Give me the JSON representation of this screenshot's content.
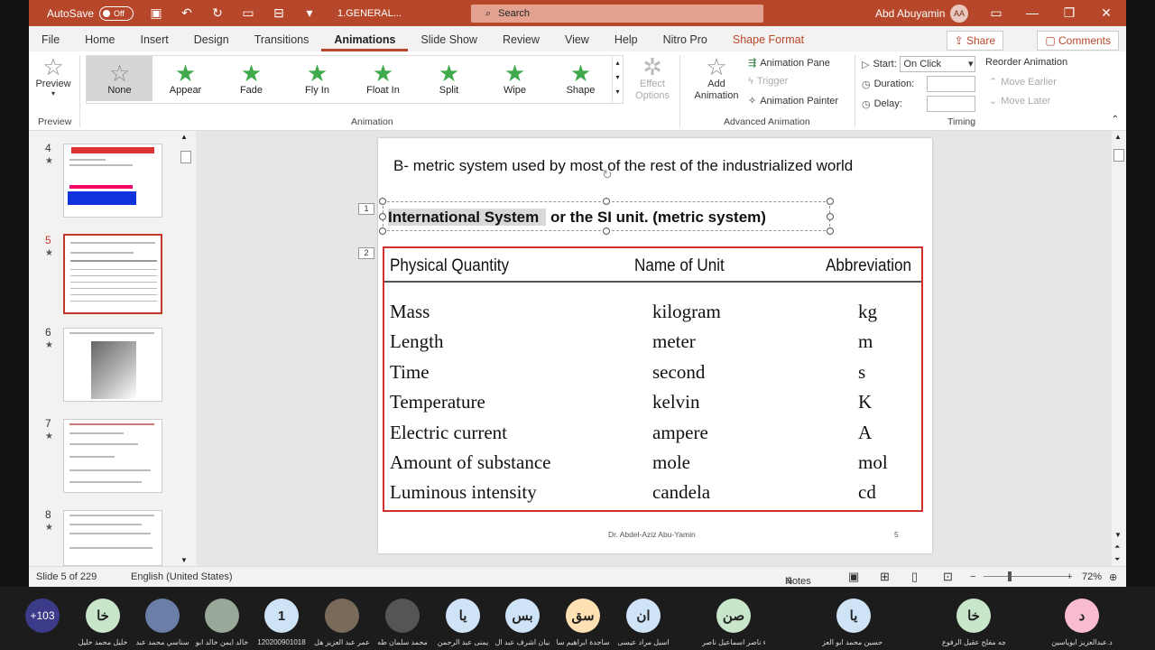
{
  "titlebar": {
    "autosave_label": "AutoSave",
    "autosave_state": "Off",
    "filename": "1.GENERAL...",
    "search_placeholder": "Search",
    "user_name": "Abd Abuyamin",
    "user_initials": "AA"
  },
  "tabs": [
    "File",
    "Home",
    "Insert",
    "Design",
    "Transitions",
    "Animations",
    "Slide Show",
    "Review",
    "View",
    "Help",
    "Nitro Pro",
    "Shape Format"
  ],
  "active_tab": "Animations",
  "share_label": "Share",
  "comments_label": "Comments",
  "ribbon": {
    "preview_label": "Preview",
    "preview_group": "Preview",
    "animation_group": "Animation",
    "gallery": [
      "None",
      "Appear",
      "Fade",
      "Fly In",
      "Float In",
      "Split",
      "Wipe",
      "Shape"
    ],
    "effect_options": "Effect Options",
    "add_animation": "Add Animation",
    "animation_pane": "Animation Pane",
    "trigger": "Trigger",
    "animation_painter": "Animation Painter",
    "advanced_group": "Advanced Animation",
    "start_label": "Start:",
    "start_value": "On Click",
    "duration_label": "Duration:",
    "delay_label": "Delay:",
    "timing_group": "Timing",
    "reorder_label": "Reorder Animation",
    "move_earlier": "Move Earlier",
    "move_later": "Move Later"
  },
  "thumbnails": [
    "4",
    "5",
    "6",
    "7",
    "8"
  ],
  "selected_thumbnail": "5",
  "slide": {
    "heading": "B- metric system used by most of the rest of the industrialized world",
    "si_highlight": "International System",
    "si_rest": " or the SI unit. (metric  system)",
    "anim_tag_1": "1",
    "anim_tag_2": "2",
    "table_headers": [
      "Physical Quantity",
      "Name of Unit",
      "Abbreviation"
    ],
    "table_rows": [
      [
        "Mass",
        "kilogram",
        "kg"
      ],
      [
        "Length",
        "meter",
        "m"
      ],
      [
        "Time",
        "second",
        "s"
      ],
      [
        "Temperature",
        "kelvin",
        "K"
      ],
      [
        "Electric current",
        "ampere",
        "A"
      ],
      [
        "Amount of substance",
        "mole",
        "mol"
      ],
      [
        "Luminous intensity",
        "candela",
        "cd"
      ]
    ],
    "footer_name": "Dr. Abdel-Aziz Abu-Yamin",
    "footer_number": "5"
  },
  "status": {
    "slide_info": "Slide 5 of 229",
    "language": "English (United States)",
    "notes": "Notes",
    "zoom": "72%"
  },
  "meeting": {
    "more_count": "+103",
    "participants": [
      {
        "initials": "خا",
        "name": "خليل محمد خليل",
        "color": "#c8e6c9"
      },
      {
        "initials": "",
        "name": "سناسي محمد عبد",
        "color": "#6a7ea8"
      },
      {
        "initials": "",
        "name": "خالد ايمن خالد ابو",
        "color": "#9aa89a"
      },
      {
        "initials": "1",
        "name": "120200901018",
        "color": "#cfe3f7"
      },
      {
        "initials": "",
        "name": "عمر عبد العزيز هل",
        "color": "#7a6a5a"
      },
      {
        "initials": "",
        "name": "محمد سلمان طه",
        "color": "#555"
      },
      {
        "initials": "يا",
        "name": "يمنى عبد الرحمن",
        "color": "#cfe3f7"
      },
      {
        "initials": "بس",
        "name": "بيان اشرف عبد ال",
        "color": "#cfe3f7"
      },
      {
        "initials": "سق",
        "name": "ساجدة ابراهيم سا",
        "color": "#ffe0b2"
      },
      {
        "initials": "ان",
        "name": "اسيل مراد عيسى",
        "color": "#cfe3f7"
      },
      {
        "initials": "صن",
        "name": "صفاء ناصر اسماعيل ناصر",
        "color": "#c8e6c9"
      },
      {
        "initials": "يا",
        "name": "يقين حسين محمد ابو العز",
        "color": "#cfe3f7"
      },
      {
        "initials": "خا",
        "name": "خديجه مفلح عقيل الرفوع",
        "color": "#c8e6c9"
      },
      {
        "initials": "د",
        "name": "د.عبدالعزيز ابوياسين",
        "color": "#f8bbd0"
      }
    ]
  }
}
